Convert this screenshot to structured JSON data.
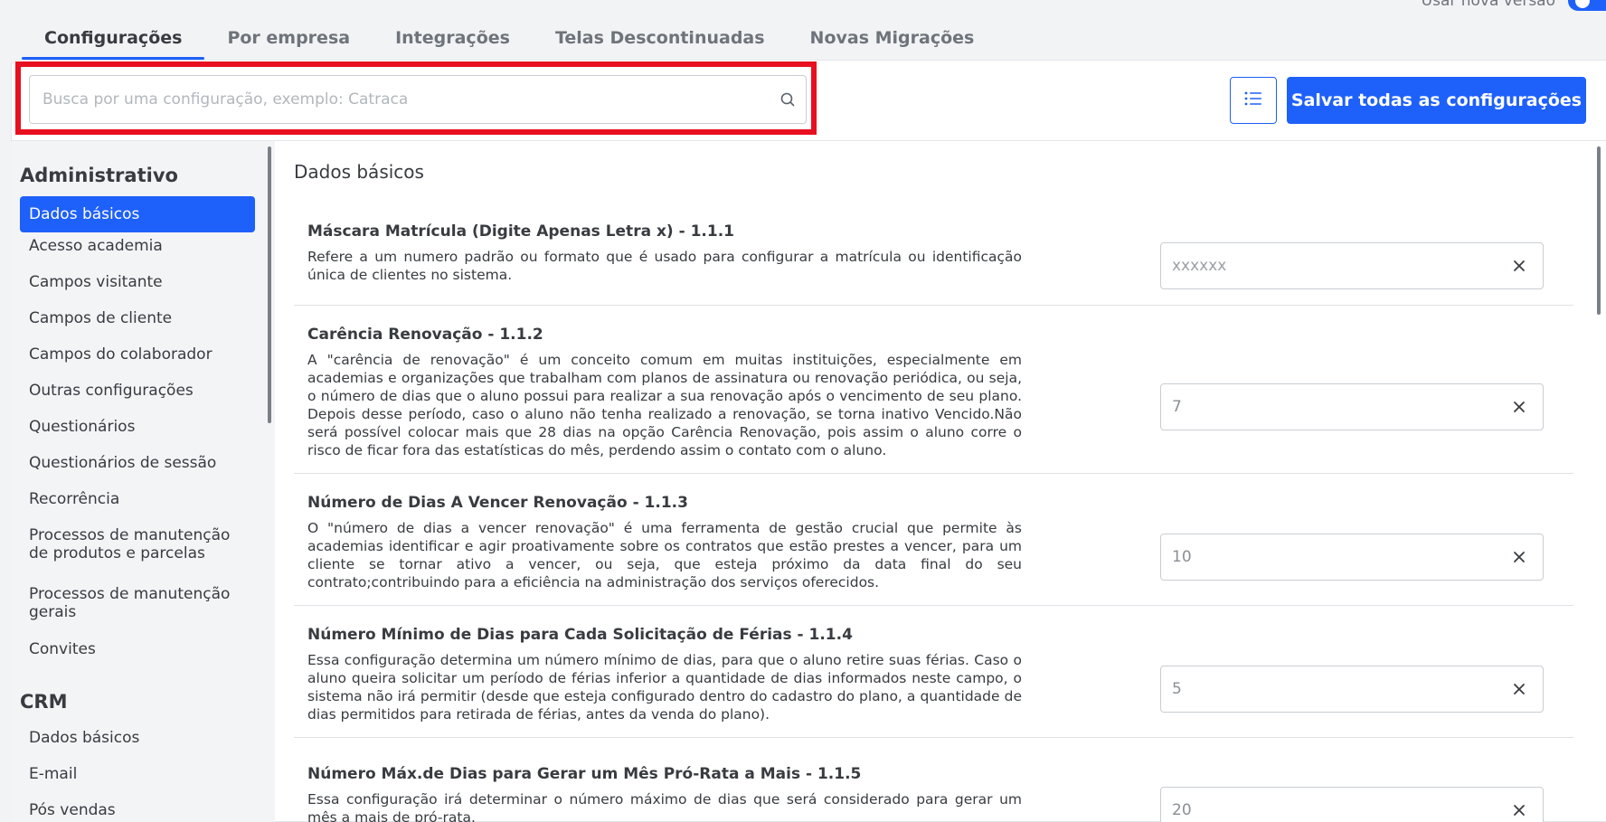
{
  "top_toggle": {
    "label": "Usar nova versão",
    "checked": true
  },
  "tabs": [
    {
      "label": "Configurações",
      "active": true
    },
    {
      "label": "Por empresa",
      "active": false
    },
    {
      "label": "Integrações",
      "active": false
    },
    {
      "label": "Telas Descontinuadas",
      "active": false
    },
    {
      "label": "Novas Migrações",
      "active": false
    }
  ],
  "search": {
    "placeholder": "Busca por uma configuração, exemplo: Catraca",
    "value": ""
  },
  "toolbar": {
    "list_icon": "list-icon",
    "save_all_label": "Salvar todas as configurações"
  },
  "sidebar": {
    "sections": [
      {
        "title": "Administrativo",
        "items": [
          {
            "label": "Dados básicos",
            "active": true
          },
          {
            "label": "Acesso academia"
          },
          {
            "label": "Campos visitante"
          },
          {
            "label": "Campos de cliente"
          },
          {
            "label": "Campos do colaborador"
          },
          {
            "label": "Outras configurações"
          },
          {
            "label": "Questionários"
          },
          {
            "label": "Questionários de sessão"
          },
          {
            "label": "Recorrência"
          },
          {
            "label": "Processos de manutenção de produtos e parcelas"
          },
          {
            "label": "Processos de manutenção gerais"
          },
          {
            "label": "Convites"
          }
        ]
      },
      {
        "title": "CRM",
        "items": [
          {
            "label": "Dados básicos"
          },
          {
            "label": "E-mail"
          },
          {
            "label": "Pós vendas"
          }
        ]
      }
    ]
  },
  "main": {
    "title": "Dados básicos",
    "items": [
      {
        "title": "Máscara Matrícula (Digite Apenas Letra x) - 1.1.1",
        "desc": "Refere a um numero padrão ou formato que é usado para configurar a matrícula ou identificação única de clientes no sistema.",
        "value": "",
        "placeholder": "xxxxxx"
      },
      {
        "title": "Carência Renovação - 1.1.2",
        "desc": "A \"carência de renovação\" é um conceito comum em muitas instituições, especialmente em academias e organizações que trabalham com planos de assinatura ou renovação periódica, ou seja, o número de dias que o aluno possui para realizar a sua renovação após o vencimento de seu plano. Depois desse período, caso o aluno não tenha realizado a renovação, se torna inativo Vencido.Não será possível colocar mais que 28 dias na opção Carência Renovação, pois assim o aluno corre o risco de ficar fora das estatísticas do mês, perdendo assim o contato com o aluno.",
        "value": "7",
        "placeholder": ""
      },
      {
        "title": "Número de Dias A Vencer Renovação - 1.1.3",
        "desc": "O \"número de dias a vencer renovação\" é uma ferramenta de gestão crucial que permite às academias identificar e agir proativamente sobre os contratos que estão prestes a vencer, para um cliente se tornar ativo a vencer, ou seja, que esteja próximo da data final do seu contrato;contribuindo para a eficiência na administração dos serviços oferecidos.",
        "value": "10",
        "placeholder": ""
      },
      {
        "title": "Número Mínimo de Dias para Cada Solicitação de Férias - 1.1.4",
        "desc": "Essa configuração determina um número mínimo de dias, para que o aluno retire suas férias. Caso o aluno queira solicitar um período de férias inferior a quantidade de dias informados neste campo, o sistema não irá permitir (desde que esteja configurado dentro do cadastro do plano, a quantidade de dias permitidos para retirada de férias, antes da venda do plano).",
        "value": "5",
        "placeholder": ""
      },
      {
        "title": "Número Máx.de Dias para Gerar um Mês Pró-Rata a Mais - 1.1.5",
        "desc": "Essa configuração irá determinar o número máximo de dias que será considerado para gerar um mês a mais de pró-rata.",
        "value": "20",
        "placeholder": ""
      }
    ]
  }
}
